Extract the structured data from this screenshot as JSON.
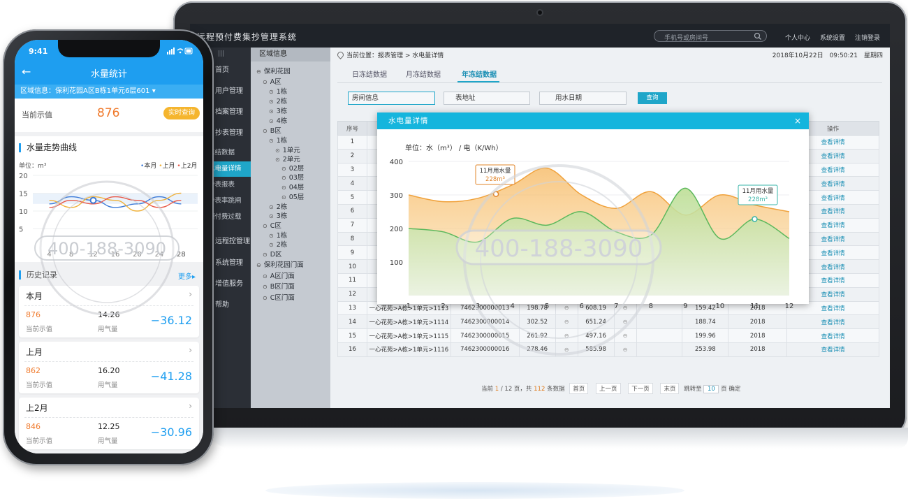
{
  "laptop": {
    "app_title": "远程预付费集抄管理系统",
    "search_placeholder": "手机号或房间号",
    "top_links": [
      "个人中心",
      "系统设置",
      "注销登录"
    ],
    "sidebar_items": [
      {
        "label": "首页",
        "sub": false
      },
      {
        "label": "用户管理",
        "sub": false
      },
      {
        "label": "档案管理",
        "sub": false
      },
      {
        "label": "抄表管理",
        "sub": false
      },
      {
        "label": "冻结数据",
        "sub": true
      },
      {
        "label": "水电量详情",
        "sub": true,
        "active": true
      },
      {
        "label": "抄表报表",
        "sub": true
      },
      {
        "label": "抄表率跳闸",
        "sub": true
      },
      {
        "label": "预付费过载",
        "sub": true
      },
      {
        "label": "远程控管理",
        "sub": false
      },
      {
        "label": "系统管理",
        "sub": false
      },
      {
        "label": "增值服务",
        "sub": false
      },
      {
        "label": "帮助",
        "sub": false
      }
    ],
    "tree": {
      "title": "区域信息",
      "nodes": [
        {
          "label": "保利花园",
          "level": 0
        },
        {
          "label": "A区",
          "level": 1
        },
        {
          "label": "1栋",
          "level": 2
        },
        {
          "label": "2栋",
          "level": 2
        },
        {
          "label": "3栋",
          "level": 2
        },
        {
          "label": "4栋",
          "level": 2
        },
        {
          "label": "B区",
          "level": 1
        },
        {
          "label": "1栋",
          "level": 2
        },
        {
          "label": "1单元",
          "level": 3
        },
        {
          "label": "2单元",
          "level": 3
        },
        {
          "label": "02层",
          "level": 4
        },
        {
          "label": "03层",
          "level": 4
        },
        {
          "label": "04层",
          "level": 4
        },
        {
          "label": "05层",
          "level": 4
        },
        {
          "label": "2栋",
          "level": 2
        },
        {
          "label": "3栋",
          "level": 2
        },
        {
          "label": "C区",
          "level": 1
        },
        {
          "label": "1栋",
          "level": 2
        },
        {
          "label": "2栋",
          "level": 2
        },
        {
          "label": "D区",
          "level": 1
        },
        {
          "label": "保利花园门面",
          "level": 0
        },
        {
          "label": "A区门面",
          "level": 1
        },
        {
          "label": "B区门面",
          "level": 1
        },
        {
          "label": "C区门面",
          "level": 1
        }
      ]
    },
    "breadcrumb": "当前位置：报表管理 > 水电量详情",
    "datetime": "2018年10月22日　09:50:21　星期四",
    "tabs": [
      {
        "label": "日冻结数据",
        "active": false
      },
      {
        "label": "月冻结数据",
        "active": false
      },
      {
        "label": "年冻结数据",
        "active": true
      }
    ],
    "filters": [
      "房间信息",
      "表地址",
      "用水日期"
    ],
    "query_label": "查询",
    "table": {
      "headers": [
        "序号",
        "",
        "",
        "",
        "",
        "",
        "",
        "",
        "操作"
      ],
      "rows": [
        {
          "n": "1",
          "room": "",
          "addr": "",
          "a": "",
          "b": "",
          "c": "",
          "year": ""
        },
        {
          "n": "2",
          "room": "",
          "addr": "",
          "a": "",
          "b": "",
          "c": "",
          "year": ""
        },
        {
          "n": "3",
          "room": "",
          "addr": "",
          "a": "",
          "b": "",
          "c": "",
          "year": ""
        },
        {
          "n": "4",
          "room": "",
          "addr": "",
          "a": "",
          "b": "",
          "c": "",
          "year": ""
        },
        {
          "n": "5",
          "room": "",
          "addr": "",
          "a": "",
          "b": "",
          "c": "",
          "year": ""
        },
        {
          "n": "6",
          "room": "",
          "addr": "",
          "a": "",
          "b": "",
          "c": "",
          "year": ""
        },
        {
          "n": "7",
          "room": "",
          "addr": "",
          "a": "",
          "b": "",
          "c": "",
          "year": ""
        },
        {
          "n": "8",
          "room": "",
          "addr": "",
          "a": "",
          "b": "",
          "c": "",
          "year": ""
        },
        {
          "n": "9",
          "room": "",
          "addr": "",
          "a": "",
          "b": "",
          "c": "",
          "year": ""
        },
        {
          "n": "10",
          "room": "",
          "addr": "",
          "a": "",
          "b": "",
          "c": "",
          "year": ""
        },
        {
          "n": "11",
          "room": "",
          "addr": "",
          "a": "",
          "b": "",
          "c": "",
          "year": ""
        },
        {
          "n": "12",
          "room": "",
          "addr": "",
          "a": "",
          "b": "",
          "c": "",
          "year": ""
        },
        {
          "n": "13",
          "room": "一心花苑>A栋>1单元>1113",
          "addr": "7462300000013",
          "a": "198.78",
          "b": "608.19",
          "c": "159.42",
          "year": "2018"
        },
        {
          "n": "14",
          "room": "一心花苑>A栋>1单元>1114",
          "addr": "7462300000014",
          "a": "302.52",
          "b": "651.24",
          "c": "188.74",
          "year": "2018"
        },
        {
          "n": "15",
          "room": "一心花苑>A栋>1单元>1115",
          "addr": "7462300000015",
          "a": "261.92",
          "b": "497.16",
          "c": "199.96",
          "year": "2018"
        },
        {
          "n": "16",
          "room": "一心花苑>A栋>1单元>1116",
          "addr": "7462300000016",
          "a": "278.46",
          "b": "585.98",
          "c": "253.98",
          "year": "2018"
        }
      ],
      "action_label": "查看详情",
      "mini_icon": "⊖"
    },
    "pager": {
      "pre": "当前",
      "cur": "1",
      "mid": " / 12 页，共",
      "total": "112",
      "post": "条数据",
      "first": "首页",
      "prev": "上一页",
      "next": "下一页",
      "last": "末页",
      "jump": "跳转至",
      "page": "10",
      "page_unit": "页",
      "ok": "确定"
    },
    "modal": {
      "title": "水电量详情",
      "close": "×",
      "unit": "单位：水（m³） /  电（K/Wh）",
      "tip_water": {
        "label": "11月用水量",
        "value": "228m³"
      },
      "tip_elec": {
        "label": "11月用水量",
        "value": "228m³"
      }
    }
  },
  "phone": {
    "time": "9:41",
    "title": "水量统计",
    "region": "区域信息：保利花园A区B栋1单元6层601",
    "current_label": "当前示值",
    "current_value": "876",
    "live_btn": "实时查询",
    "trend_title": "水量走势曲线",
    "unit": "单位：m³",
    "legend": [
      "本月",
      "上月",
      "上2月"
    ],
    "history_title": "历史记录",
    "more": "更多▸",
    "history": [
      {
        "title": "本月",
        "v1": "876",
        "l1": "当前示值",
        "v2": "14.26",
        "l2": "用气量",
        "diff": "−36.12"
      },
      {
        "title": "上月",
        "v1": "862",
        "l1": "当前示值",
        "v2": "16.20",
        "l2": "用气量",
        "diff": "−41.28"
      },
      {
        "title": "上2月",
        "v1": "846",
        "l1": "当前示值",
        "v2": "12.25",
        "l2": "用气量",
        "diff": "−30.96"
      }
    ]
  },
  "colors": {
    "accent": "#1fa6c9",
    "phone_blue": "#1e9ef0",
    "orange": "#f0a23c",
    "green": "#5cb85c",
    "sidebar_dark": "#2b2f36"
  },
  "watermark": {
    "phone": "400-188-3090",
    "laptop": "400-188-3090"
  },
  "chart_data": [
    {
      "type": "area",
      "x": [
        1,
        2,
        3,
        4,
        5,
        6,
        7,
        8,
        9,
        10,
        11,
        12
      ],
      "ylim": [
        0,
        400
      ],
      "yticks": [
        100,
        200,
        300,
        400
      ],
      "series": [
        {
          "values": [
            300,
            280,
            290,
            330,
            380,
            300,
            260,
            310,
            240,
            300,
            270,
            250
          ]
        },
        {
          "values": [
            200,
            190,
            160,
            230,
            210,
            250,
            190,
            180,
            320,
            170,
            228,
            170
          ]
        }
      ]
    },
    {
      "type": "line",
      "x": [
        4,
        8,
        12,
        16,
        20,
        24,
        28
      ],
      "yticks": [
        5,
        10,
        15,
        20
      ],
      "ylim": [
        0,
        20
      ],
      "series": [
        {
          "name": "本月",
          "values": [
            12,
            14,
            13,
            11,
            12,
            14,
            12
          ]
        },
        {
          "name": "上月",
          "values": [
            13,
            11,
            14,
            13,
            10,
            13,
            15
          ]
        },
        {
          "name": "上2月",
          "values": [
            11,
            13,
            12,
            14,
            13,
            11,
            13
          ]
        }
      ]
    }
  ]
}
